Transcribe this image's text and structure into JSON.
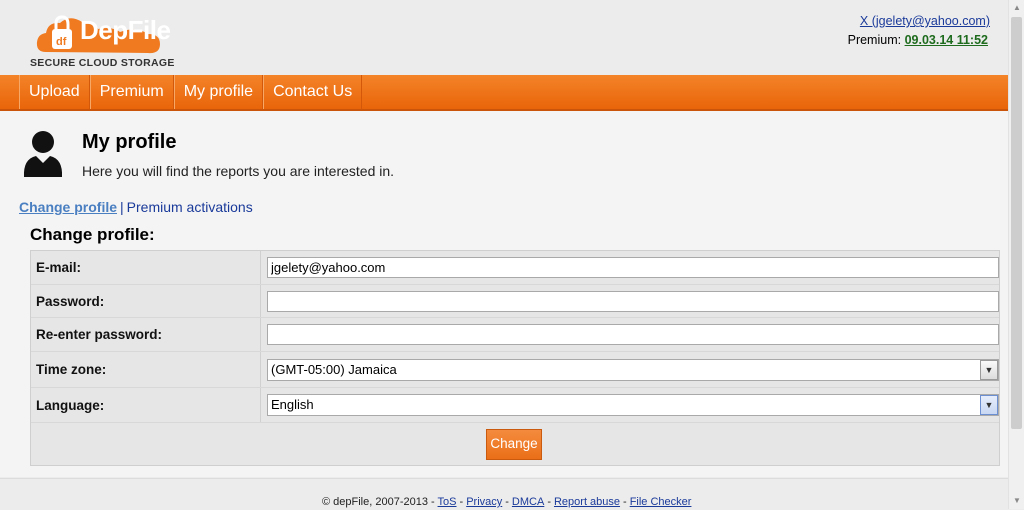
{
  "brand": {
    "name": "DepFile",
    "tagline": "SECURE CLOUD STORAGE",
    "colors": {
      "orange": "#f07a20",
      "link": "#1a3a9a",
      "premium_date": "#1e6b1e"
    }
  },
  "header": {
    "user_link": "X (jgelety@yahoo.com)",
    "premium_label": "Premium:",
    "premium_date": "09.03.14 11:52"
  },
  "nav": {
    "items": [
      {
        "label": "Upload"
      },
      {
        "label": "Premium"
      },
      {
        "label": "My profile"
      },
      {
        "label": "Contact Us"
      }
    ]
  },
  "page": {
    "icon": "user-silhouette-icon",
    "title": "My profile",
    "subtitle": "Here you will find the reports you are interested in."
  },
  "sublinks": {
    "active": "Change profile",
    "separator": "|",
    "other": "Premium activations"
  },
  "form": {
    "title": "Change profile:",
    "email_label": "E-mail:",
    "email_value": "jgelety@yahoo.com",
    "password_label": "Password:",
    "password_value": "",
    "reenter_label": "Re-enter password:",
    "reenter_value": "",
    "timezone_label": "Time zone:",
    "timezone_value": "(GMT-05:00) Jamaica",
    "language_label": "Language:",
    "language_value": "English",
    "submit_label": "Change"
  },
  "footer": {
    "copyright": "© depFile, 2007-2013 -",
    "links": [
      "ToS",
      "Privacy",
      "DMCA",
      "Report abuse",
      "File Checker"
    ]
  }
}
